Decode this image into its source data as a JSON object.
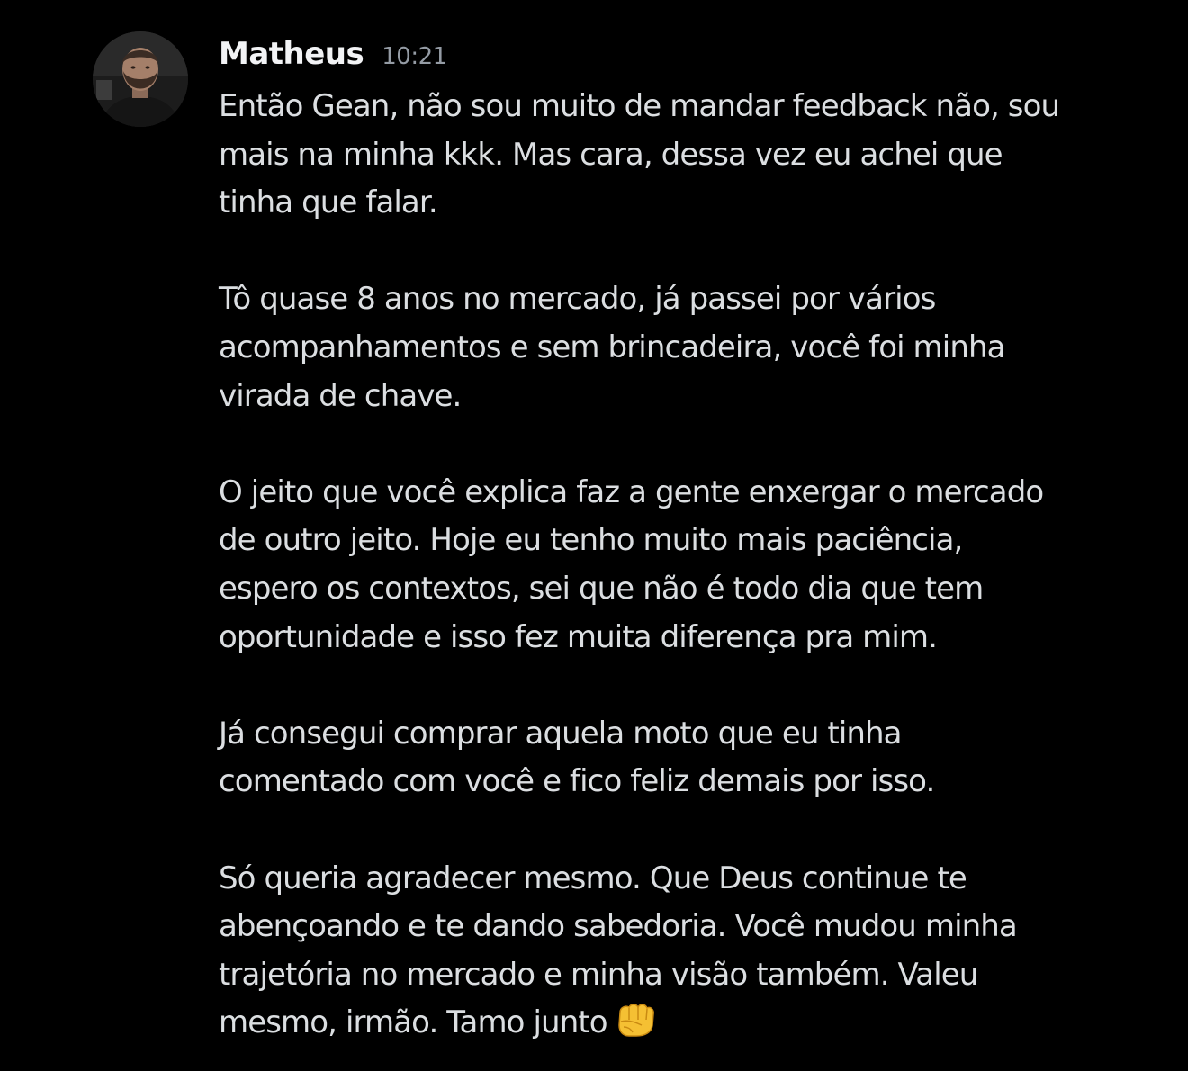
{
  "message": {
    "author": "Matheus",
    "timestamp": "10:21",
    "avatar_icon": "user-photo-avatar",
    "reaction_emoji": "fist-bump-icon",
    "paragraphs": [
      {
        "lines": [
          "Então Gean, não sou muito de mandar feedback não, sou",
          "mais na minha kkk. Mas cara, dessa vez eu achei que",
          "tinha que falar."
        ]
      },
      {
        "lines": [
          "Tô quase 8 anos no mercado, já passei por vários",
          "acompanhamentos e sem brincadeira, você foi minha",
          "virada de chave."
        ]
      },
      {
        "lines": [
          "O jeito que você explica faz a gente enxergar o mercado",
          "de outro jeito. Hoje eu tenho muito mais paciência,",
          "espero os contextos, sei que não é todo dia que tem",
          "oportunidade e isso fez muita diferença pra mim."
        ]
      },
      {
        "lines": [
          "Já consegui comprar aquela moto que eu tinha",
          "comentado com você e fico feliz demais por isso."
        ]
      },
      {
        "lines": [
          "Só queria agradecer mesmo. Que Deus continue te",
          "abençoando e te dando sabedoria. Você mudou minha",
          "trajetória no mercado e minha visão também. Valeu",
          "mesmo, irmão. Tamo junto"
        ]
      }
    ]
  },
  "colors": {
    "background": "#000000",
    "author": "#f2f3f5",
    "timestamp": "#949ba4",
    "text": "#dbdee1",
    "emoji": "#f5c033"
  }
}
